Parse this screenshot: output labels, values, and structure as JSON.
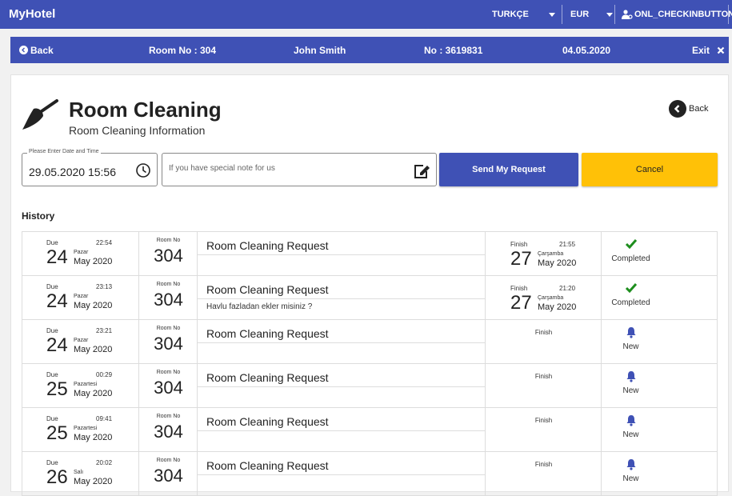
{
  "topbar": {
    "brand": "MyHotel",
    "language": "TURKÇE",
    "currency": "EUR",
    "user": "ONL_CHECKINBUTTON"
  },
  "infobar": {
    "back": "Back",
    "room": "Room No : 304",
    "guest": "John Smith",
    "number": "No : 3619831",
    "date": "04.05.2020",
    "exit": "Exit"
  },
  "page": {
    "title": "Room Cleaning",
    "subtitle": "Room Cleaning Information",
    "back": "Back"
  },
  "form": {
    "date_label": "Please Enter Date and Time",
    "date_value": "29.05.2020 15:56",
    "note_placeholder": "If you have special note for us",
    "send_label": "Send My Request",
    "cancel_label": "Cancel"
  },
  "history": {
    "heading": "History",
    "due_label": "Due",
    "room_label": "Room No",
    "finish_label": "Finish",
    "rows": [
      {
        "due_time": "22:54",
        "due_day": "24",
        "due_weekday": "Pazar",
        "due_month": "May 2020",
        "room": "304",
        "title": "Room Cleaning Request",
        "note": "",
        "finish_time": "21:55",
        "finish_day": "27",
        "finish_weekday": "Çarşamba",
        "finish_month": "May 2020",
        "status": "Completed"
      },
      {
        "due_time": "23:13",
        "due_day": "24",
        "due_weekday": "Pazar",
        "due_month": "May 2020",
        "room": "304",
        "title": "Room Cleaning Request",
        "note": "Havlu fazladan ekler misiniz ?",
        "finish_time": "21:20",
        "finish_day": "27",
        "finish_weekday": "Çarşamba",
        "finish_month": "May 2020",
        "status": "Completed"
      },
      {
        "due_time": "23:21",
        "due_day": "24",
        "due_weekday": "Pazar",
        "due_month": "May 2020",
        "room": "304",
        "title": "Room Cleaning Request",
        "note": "",
        "status": "New"
      },
      {
        "due_time": "00:29",
        "due_day": "25",
        "due_weekday": "Pazartesi",
        "due_month": "May 2020",
        "room": "304",
        "title": "Room Cleaning Request",
        "note": "",
        "status": "New"
      },
      {
        "due_time": "09:41",
        "due_day": "25",
        "due_weekday": "Pazartesi",
        "due_month": "May 2020",
        "room": "304",
        "title": "Room Cleaning Request",
        "note": "",
        "status": "New"
      },
      {
        "due_time": "20:02",
        "due_day": "26",
        "due_weekday": "Salı",
        "due_month": "May 2020",
        "room": "304",
        "title": "Room Cleaning Request",
        "note": "",
        "status": "New"
      }
    ]
  },
  "colors": {
    "primary": "#3f51b5",
    "accent": "#ffc107",
    "success": "#1e8e1e",
    "new": "#3f51b5"
  }
}
